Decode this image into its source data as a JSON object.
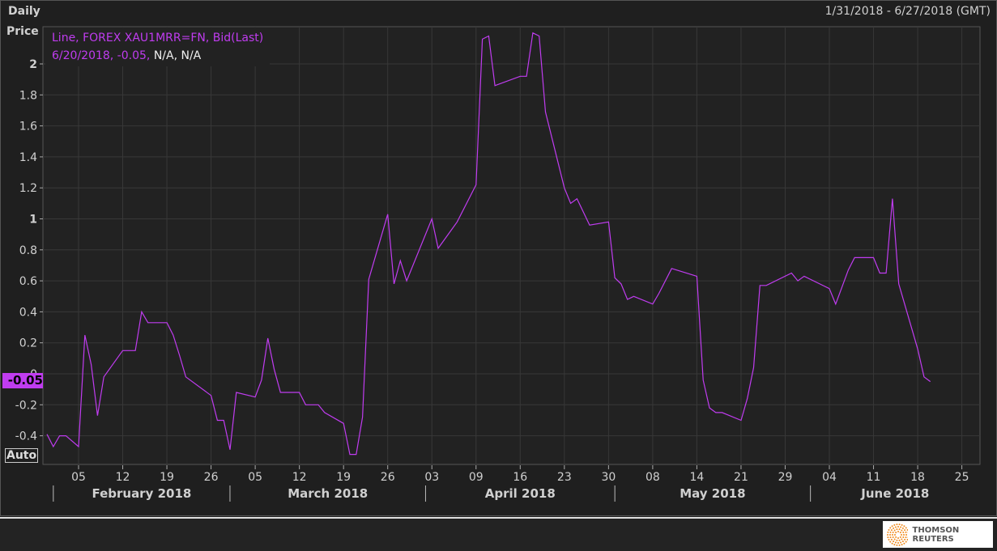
{
  "header": {
    "frequency": "Daily",
    "y_title": "Price",
    "date_range": "1/31/2018 - 6/27/2018 (GMT)"
  },
  "legend": {
    "line1": "Line, FOREX XAU1MRR=FN, Bid(Last)",
    "line2_colored": "6/20/2018, -0.05,",
    "line2_white": "N/A, N/A"
  },
  "current_value_label": "-0.05",
  "auto_button": "Auto",
  "logo_text": "THOMSON REUTERS",
  "colors": {
    "line": "#c03cf0",
    "grid": "#383838",
    "background": "#222222"
  },
  "chart_data": {
    "type": "line",
    "title": "FOREX XAU1MRR=FN, Bid(Last)",
    "xlabel": "",
    "ylabel": "Price",
    "ylim": [
      -0.6,
      2.3
    ],
    "y_ticks": [
      -0.4,
      -0.2,
      0,
      0.2,
      0.4,
      0.6,
      0.8,
      1,
      1.2,
      1.4,
      1.6,
      1.8,
      2
    ],
    "y_tick_labels": [
      "-0.4",
      "-0.2",
      "0",
      "0.2",
      "0.4",
      "0.6",
      "0.8",
      "1",
      "1.2",
      "1.4",
      "1.6",
      "1.8",
      "2"
    ],
    "x_ticks": [
      {
        "date": "2018-02-05",
        "label": "05"
      },
      {
        "date": "2018-02-12",
        "label": "12"
      },
      {
        "date": "2018-02-19",
        "label": "19"
      },
      {
        "date": "2018-02-26",
        "label": "26"
      },
      {
        "date": "2018-03-05",
        "label": "05"
      },
      {
        "date": "2018-03-12",
        "label": "12"
      },
      {
        "date": "2018-03-19",
        "label": "19"
      },
      {
        "date": "2018-03-26",
        "label": "26"
      },
      {
        "date": "2018-04-02",
        "label": "03"
      },
      {
        "date": "2018-04-09",
        "label": "09"
      },
      {
        "date": "2018-04-16",
        "label": "16"
      },
      {
        "date": "2018-04-23",
        "label": "23"
      },
      {
        "date": "2018-04-30",
        "label": "30"
      },
      {
        "date": "2018-05-07",
        "label": "08"
      },
      {
        "date": "2018-05-14",
        "label": "14"
      },
      {
        "date": "2018-05-21",
        "label": "21"
      },
      {
        "date": "2018-05-28",
        "label": "29"
      },
      {
        "date": "2018-06-04",
        "label": "04"
      },
      {
        "date": "2018-06-11",
        "label": "11"
      },
      {
        "date": "2018-06-18",
        "label": "18"
      },
      {
        "date": "2018-06-25",
        "label": "25"
      }
    ],
    "months": [
      {
        "start": "2018-02-01",
        "end": "2018-03-01",
        "label": "February 2018"
      },
      {
        "start": "2018-03-01",
        "end": "2018-04-01",
        "label": "March 2018"
      },
      {
        "start": "2018-04-01",
        "end": "2018-05-01",
        "label": "April 2018"
      },
      {
        "start": "2018-05-01",
        "end": "2018-06-01",
        "label": "May 2018"
      },
      {
        "start": "2018-06-01",
        "end": "2018-06-28",
        "label": "June 2018"
      }
    ],
    "xlim": [
      "2018-01-31",
      "2018-06-28"
    ],
    "series": [
      {
        "name": "XAU1MRR=FN Bid",
        "points": [
          [
            "2018-01-31",
            -0.39
          ],
          [
            "2018-02-01",
            -0.47
          ],
          [
            "2018-02-02",
            -0.4
          ],
          [
            "2018-02-03",
            -0.4
          ],
          [
            "2018-02-05",
            -0.47
          ],
          [
            "2018-02-06",
            0.25
          ],
          [
            "2018-02-07",
            0.06
          ],
          [
            "2018-02-08",
            -0.27
          ],
          [
            "2018-02-09",
            -0.02
          ],
          [
            "2018-02-12",
            0.15
          ],
          [
            "2018-02-14",
            0.15
          ],
          [
            "2018-02-15",
            0.4
          ],
          [
            "2018-02-16",
            0.33
          ],
          [
            "2018-02-19",
            0.33
          ],
          [
            "2018-02-20",
            0.25
          ],
          [
            "2018-02-21",
            0.12
          ],
          [
            "2018-02-22",
            -0.02
          ],
          [
            "2018-02-26",
            -0.14
          ],
          [
            "2018-02-27",
            -0.3
          ],
          [
            "2018-02-28",
            -0.3
          ],
          [
            "2018-03-01",
            -0.49
          ],
          [
            "2018-03-02",
            -0.12
          ],
          [
            "2018-03-05",
            -0.15
          ],
          [
            "2018-03-06",
            -0.04
          ],
          [
            "2018-03-07",
            0.23
          ],
          [
            "2018-03-08",
            0.03
          ],
          [
            "2018-03-09",
            -0.12
          ],
          [
            "2018-03-12",
            -0.12
          ],
          [
            "2018-03-13",
            -0.2
          ],
          [
            "2018-03-15",
            -0.2
          ],
          [
            "2018-03-16",
            -0.25
          ],
          [
            "2018-03-19",
            -0.32
          ],
          [
            "2018-03-20",
            -0.52
          ],
          [
            "2018-03-21",
            -0.52
          ],
          [
            "2018-03-22",
            -0.28
          ],
          [
            "2018-03-23",
            0.61
          ],
          [
            "2018-03-26",
            1.03
          ],
          [
            "2018-03-27",
            0.58
          ],
          [
            "2018-03-28",
            0.73
          ],
          [
            "2018-03-29",
            0.6
          ],
          [
            "2018-04-02",
            1.0
          ],
          [
            "2018-04-03",
            0.81
          ],
          [
            "2018-04-06",
            0.98
          ],
          [
            "2018-04-09",
            1.22
          ],
          [
            "2018-04-10",
            2.16
          ],
          [
            "2018-04-11",
            2.18
          ],
          [
            "2018-04-12",
            1.86
          ],
          [
            "2018-04-16",
            1.92
          ],
          [
            "2018-04-17",
            1.92
          ],
          [
            "2018-04-18",
            2.2
          ],
          [
            "2018-04-19",
            2.18
          ],
          [
            "2018-04-20",
            1.69
          ],
          [
            "2018-04-23",
            1.2
          ],
          [
            "2018-04-24",
            1.1
          ],
          [
            "2018-04-25",
            1.13
          ],
          [
            "2018-04-27",
            0.96
          ],
          [
            "2018-04-30",
            0.98
          ],
          [
            "2018-05-01",
            0.62
          ],
          [
            "2018-05-02",
            0.58
          ],
          [
            "2018-05-03",
            0.48
          ],
          [
            "2018-05-04",
            0.5
          ],
          [
            "2018-05-07",
            0.45
          ],
          [
            "2018-05-08",
            0.52
          ],
          [
            "2018-05-10",
            0.68
          ],
          [
            "2018-05-14",
            0.63
          ],
          [
            "2018-05-15",
            -0.04
          ],
          [
            "2018-05-16",
            -0.22
          ],
          [
            "2018-05-17",
            -0.25
          ],
          [
            "2018-05-18",
            -0.25
          ],
          [
            "2018-05-21",
            -0.3
          ],
          [
            "2018-05-22",
            -0.16
          ],
          [
            "2018-05-23",
            0.04
          ],
          [
            "2018-05-24",
            0.57
          ],
          [
            "2018-05-25",
            0.57
          ],
          [
            "2018-05-29",
            0.65
          ],
          [
            "2018-05-30",
            0.6
          ],
          [
            "2018-05-31",
            0.63
          ],
          [
            "2018-06-04",
            0.55
          ],
          [
            "2018-06-05",
            0.45
          ],
          [
            "2018-06-06",
            0.56
          ],
          [
            "2018-06-07",
            0.67
          ],
          [
            "2018-06-08",
            0.75
          ],
          [
            "2018-06-11",
            0.75
          ],
          [
            "2018-06-12",
            0.65
          ],
          [
            "2018-06-13",
            0.65
          ],
          [
            "2018-06-14",
            1.13
          ],
          [
            "2018-06-15",
            0.58
          ],
          [
            "2018-06-18",
            0.16
          ],
          [
            "2018-06-19",
            -0.02
          ],
          [
            "2018-06-20",
            -0.05
          ]
        ]
      }
    ]
  }
}
